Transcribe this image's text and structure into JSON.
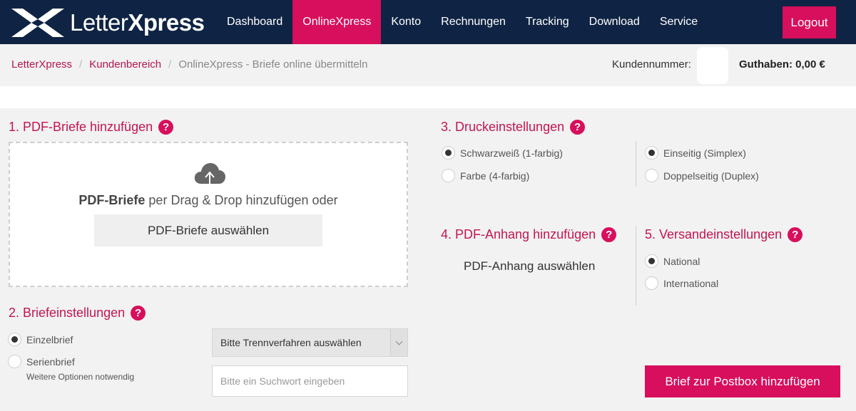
{
  "logo": {
    "text_light": "Letter",
    "text_bold": "Xpress",
    "icon": "letterxpress-x-logo"
  },
  "nav": {
    "items": [
      {
        "label": "Dashboard"
      },
      {
        "label": "OnlineXpress"
      },
      {
        "label": "Konto"
      },
      {
        "label": "Rechnungen"
      },
      {
        "label": "Tracking"
      },
      {
        "label": "Download"
      },
      {
        "label": "Service"
      }
    ],
    "active": "OnlineXpress",
    "logout": "Logout"
  },
  "breadcrumb": {
    "items": [
      "LetterXpress",
      "Kundenbereich",
      "OnlineXpress - Briefe online übermitteln"
    ],
    "separator": "/"
  },
  "account": {
    "customer_label": "Kundennummer:",
    "balance": "Guthaben: 0,00 €"
  },
  "section1": {
    "title": "1. PDF-Briefe hinzufügen",
    "help": "?",
    "upload_icon": "cloud-upload-icon",
    "drop_bold": "PDF-Briefe",
    "drop_rest": " per Drag & Drop hinzufügen oder",
    "select_button": "PDF-Briefe auswählen"
  },
  "section2": {
    "title": "2. Briefeinstellungen",
    "help": "?",
    "options": [
      {
        "label": "Einzelbrief",
        "selected": true
      },
      {
        "label": "Serienbrief",
        "selected": false
      }
    ],
    "hint": "Weitere Optionen notwendig",
    "separator_select": "Bitte Trennverfahren auswählen",
    "search_placeholder": "Bitte ein Suchwort eingeben"
  },
  "section3": {
    "title": "3. Druckeinstellungen",
    "help": "?",
    "color_options": [
      {
        "label": "Schwarzweiß (1-farbig)",
        "selected": true
      },
      {
        "label": "Farbe (4-farbig)",
        "selected": false
      }
    ],
    "duplex_options": [
      {
        "label": "Einseitig (Simplex)",
        "selected": true
      },
      {
        "label": "Doppelseitig (Duplex)",
        "selected": false
      }
    ]
  },
  "section4": {
    "title": "4. PDF-Anhang hinzufügen",
    "help": "?",
    "button": "PDF-Anhang auswählen"
  },
  "section5": {
    "title": "5. Versandeinstellungen",
    "help": "?",
    "options": [
      {
        "label": "National",
        "selected": true
      },
      {
        "label": "International",
        "selected": false
      }
    ]
  },
  "cta": "Brief zur Postbox hinzufügen",
  "colors": {
    "navy": "#0f2444",
    "accent": "#d70f5c",
    "accent_text": "#c4154f",
    "panel": "#f2f2f2"
  }
}
